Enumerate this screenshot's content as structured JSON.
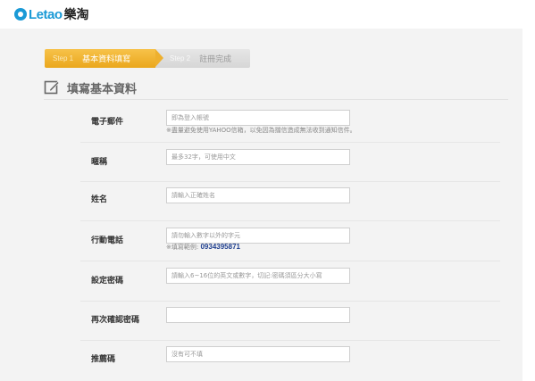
{
  "header": {
    "logo_latin": "Letao",
    "logo_cjk": "樂淘"
  },
  "steps": [
    {
      "num": "Step 1",
      "label": "基本資料填寫",
      "state": "active"
    },
    {
      "num": "Step 2",
      "label": "註冊完成",
      "state": "inactive"
    }
  ],
  "section": {
    "title": "填寫基本資料",
    "icon": "pencil-edit-icon"
  },
  "colors": {
    "accent_orange": "#eeb02e",
    "brand_blue": "#1a9ad6",
    "example_blue": "#1f3f8f",
    "page_bg": "#f3f3f3"
  },
  "form": {
    "email": {
      "label": "電子郵件",
      "placeholder": "即為登入帳號",
      "value": "",
      "hint": "※盡量避免使用YAHOO信箱，以免因為擋信造成無法收到通知信件。"
    },
    "nickname": {
      "label": "暱稱",
      "placeholder": "最多32字，可使用中文",
      "value": ""
    },
    "name": {
      "label": "姓名",
      "placeholder": "請輸入正確姓名",
      "value": ""
    },
    "mobile": {
      "label": "行動電話",
      "placeholder": "請勿輸入數字以外的字元",
      "value": "",
      "hint_prefix": "※填寫範例:",
      "hint_example": "0934395871"
    },
    "password": {
      "label": "設定密碼",
      "placeholder": "請輸入6~16位的英文或數字，切記:密碼須區分大小寫",
      "value": ""
    },
    "password_confirm": {
      "label": "再次確認密碼",
      "placeholder": "",
      "value": ""
    },
    "referral": {
      "label": "推薦碼",
      "placeholder": "沒有可不填",
      "value": ""
    }
  }
}
